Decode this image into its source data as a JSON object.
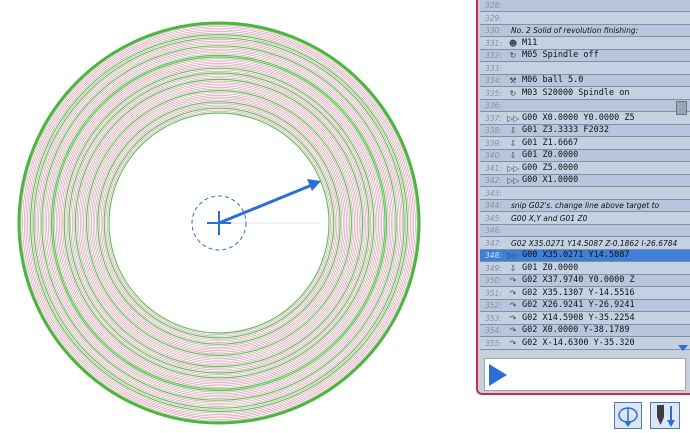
{
  "colors": {
    "path_green": "#46b83c",
    "path_pink": "#c9889a",
    "tool_blue": "#2a6fd8",
    "panel_border": "#c4304a",
    "row_bg": "#b7c6dc",
    "row_selected": "#3f7fd6"
  },
  "listing": {
    "rows": [
      {
        "line": "328:",
        "icon": "",
        "html": ""
      },
      {
        "line": "329:",
        "icon": "",
        "html": ""
      },
      {
        "line": "330:",
        "icon": "",
        "html": "No. 2 Solid of revolution finishing:"
      },
      {
        "line": "331:",
        "icon": "person-icon",
        "html": "M11"
      },
      {
        "line": "332:",
        "icon": "spindle-icon",
        "html": "M05  Spindle off"
      },
      {
        "line": "333:",
        "icon": "",
        "html": ""
      },
      {
        "line": "334:",
        "icon": "wrench-icon",
        "html": "M06  ball 5.0"
      },
      {
        "line": "335:",
        "icon": "spindle-icon",
        "html": "M03  S20000  Spindle on"
      },
      {
        "line": "336:",
        "icon": "",
        "html": ""
      },
      {
        "line": "337:",
        "icon": "rapid-icon",
        "html": "G00  X0.0000  Y0.0000  Z5"
      },
      {
        "line": "338:",
        "icon": "feed-down-icon",
        "html": "G01  Z3.3333  F2032"
      },
      {
        "line": "339:",
        "icon": "feed-down-icon",
        "html": "G01  Z1.6667"
      },
      {
        "line": "340:",
        "icon": "feed-down-icon",
        "html": "G01  Z0.0000"
      },
      {
        "line": "341:",
        "icon": "rapid-icon",
        "html": "G00  Z5.0000"
      },
      {
        "line": "342:",
        "icon": "rapid-icon",
        "html": "G00  X1.0000"
      },
      {
        "line": "343:",
        "icon": "",
        "html": ""
      },
      {
        "line": "344:",
        "icon": "",
        "html": "snip G02's. change line above target to"
      },
      {
        "line": "345:",
        "icon": "",
        "html": "G00 X,Y and G01 Z0"
      },
      {
        "line": "346:",
        "icon": "",
        "html": ""
      },
      {
        "line": "347:",
        "icon": "",
        "html": "G02 X35.0271 Y14.5087 Z-0.1862 I-26.6784"
      },
      {
        "line": "348:",
        "icon": "rapid-icon",
        "html": "G00  X35.0271  Y14.5087"
      },
      {
        "line": "349:",
        "icon": "feed-down-icon",
        "html": "G01  Z0.0000"
      },
      {
        "line": "350:",
        "icon": "arc-icon",
        "html": "G02  X37.9740  Y0.0000  Z"
      },
      {
        "line": "351:",
        "icon": "arc-icon",
        "html": "G02  X35.1307  Y-14.5516"
      },
      {
        "line": "352:",
        "icon": "arc-icon",
        "html": "G02  X26.9241  Y-26.9241"
      },
      {
        "line": "353:",
        "icon": "arc-icon",
        "html": "G02  X14.5908  Y-35.2254"
      },
      {
        "line": "354:",
        "icon": "arc-icon",
        "html": "G02  X0.0000  Y-38.1789"
      },
      {
        "line": "355:",
        "icon": "arc-icon",
        "html": "G02  X-14.6300  Y-35.320"
      }
    ],
    "selected_index": 20
  },
  "icons": {
    "play": "play-icon",
    "toolpath_view": "toolpath-view-icon",
    "tool_down": "tool-down-icon"
  }
}
